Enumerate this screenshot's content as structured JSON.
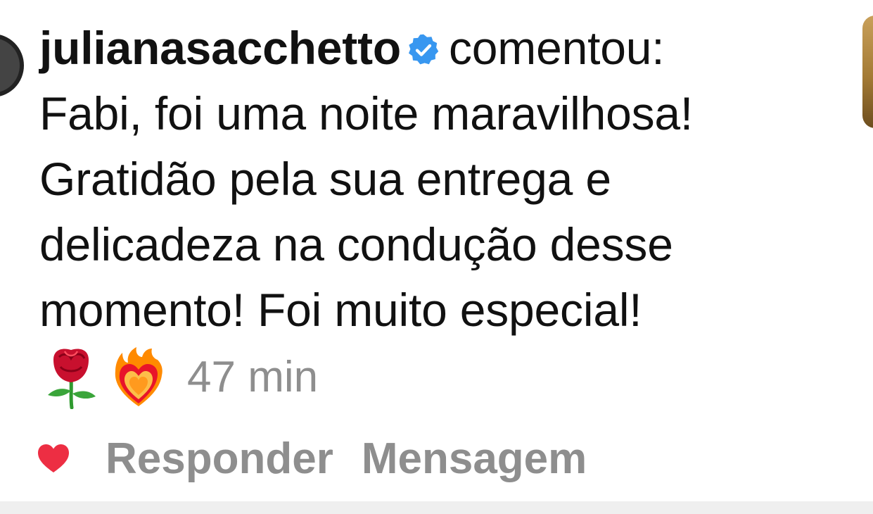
{
  "comment": {
    "username": "julianasacchetto",
    "action_text": "comentou:",
    "lines": [
      "Fabi, foi uma noite maravilhosa!",
      "Gratidão pela sua entrega e",
      "delicadeza na condução desse",
      "momento! Foi muito especial!"
    ],
    "emojis": [
      "rose-emoji",
      "heart-on-fire-emoji"
    ],
    "time": "47 min"
  },
  "actions": {
    "reply_label": "Responder",
    "message_label": "Mensagem"
  },
  "icons": {
    "verified": "verified-badge-icon",
    "like": "heart-icon"
  },
  "colors": {
    "verified_blue": "#3897f0",
    "heart_red": "#ed2e43",
    "muted_text": "#8e8e8e",
    "body_text": "#111111"
  }
}
